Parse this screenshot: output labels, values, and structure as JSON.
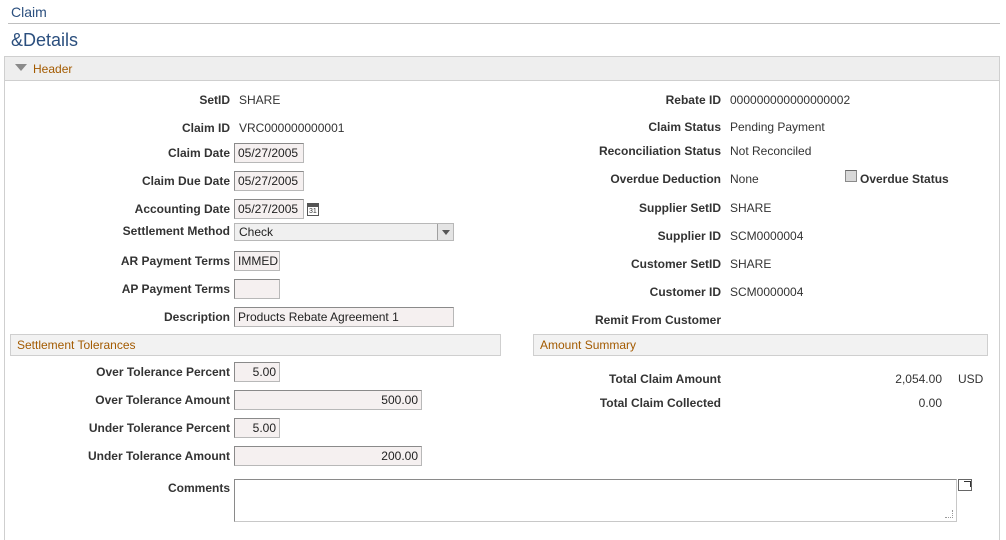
{
  "breadcrumb": "Claim",
  "page_title": "&Details",
  "header_section": {
    "label": "Header"
  },
  "left": {
    "setid_label": "SetID",
    "setid_value": "SHARE",
    "claim_id_label": "Claim ID",
    "claim_id_value": "VRC000000000001",
    "claim_date_label": "Claim Date",
    "claim_date_value": "05/27/2005",
    "claim_due_date_label": "Claim Due Date",
    "claim_due_date_value": "05/27/2005",
    "accounting_date_label": "Accounting Date",
    "accounting_date_value": "05/27/2005",
    "settlement_method_label": "Settlement Method",
    "settlement_method_value": "Check",
    "ar_terms_label": "AR Payment Terms",
    "ar_terms_value": "IMMED",
    "ap_terms_label": "AP Payment Terms",
    "ap_terms_value": "",
    "description_label": "Description",
    "description_value": "Products Rebate Agreement 1"
  },
  "right": {
    "rebate_id_label": "Rebate ID",
    "rebate_id_value": "000000000000000002",
    "claim_status_label": "Claim Status",
    "claim_status_value": "Pending Payment",
    "recon_status_label": "Reconciliation Status",
    "recon_status_value": "Not Reconciled",
    "overdue_deduction_label": "Overdue Deduction",
    "overdue_deduction_value": "None",
    "overdue_status_label": "Overdue Status",
    "supplier_setid_label": "Supplier SetID",
    "supplier_setid_value": "SHARE",
    "supplier_id_label": "Supplier ID",
    "supplier_id_value": "SCM0000004",
    "customer_setid_label": "Customer SetID",
    "customer_setid_value": "SHARE",
    "customer_id_label": "Customer ID",
    "customer_id_value": "SCM0000004",
    "remit_label": "Remit From Customer"
  },
  "tolerances": {
    "title": "Settlement Tolerances",
    "over_pct_label": "Over Tolerance Percent",
    "over_pct_value": "5.00",
    "over_amt_label": "Over Tolerance Amount",
    "over_amt_value": "500.00",
    "under_pct_label": "Under Tolerance Percent",
    "under_pct_value": "5.00",
    "under_amt_label": "Under Tolerance Amount",
    "under_amt_value": "200.00"
  },
  "amount_summary": {
    "title": "Amount Summary",
    "total_claim_label": "Total Claim Amount",
    "total_claim_value": "2,054.00",
    "currency": "USD",
    "total_collected_label": "Total Claim Collected",
    "total_collected_value": "0.00"
  },
  "comments": {
    "label": "Comments",
    "value": ""
  },
  "icons": {
    "calendar": "calendar-icon",
    "dropdown": "chevron-down-icon",
    "collapse": "collapse-triangle-icon",
    "expand": "expand-window-icon"
  },
  "colors": {
    "title": "#2b4f7e",
    "section_label": "#a35a00"
  }
}
